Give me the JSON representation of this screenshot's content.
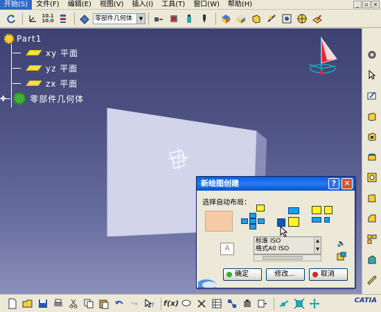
{
  "menu": {
    "items": [
      {
        "label": "开始(S)"
      },
      {
        "label": "文件(F)"
      },
      {
        "label": "编辑(E)"
      },
      {
        "label": "视图(V)"
      },
      {
        "label": "插入(I)"
      },
      {
        "label": "工具(T)"
      },
      {
        "label": "窗口(W)"
      },
      {
        "label": "帮助(H)"
      }
    ]
  },
  "toolbar_top": {
    "scale_text": "10.1\n10.0",
    "geometry_select": "零部件几何体"
  },
  "tree": {
    "root": "Part1",
    "planes": [
      "xy 平面",
      "yz 平面",
      "zx 平面"
    ],
    "geometry": "零部件几何体"
  },
  "dialog": {
    "title": "新绘图创建",
    "help": "?",
    "close": "✕",
    "section_label": "选择自动布局：",
    "preview_letter": "A",
    "standards": [
      "标准 ISO",
      "格式A0 ISO"
    ],
    "ok": "确定",
    "modify": "修改...",
    "cancel": "取消"
  },
  "brand": {
    "catia": "CATIA"
  },
  "colors": {
    "title_bar": "#0a5fe5",
    "viewport_top": "#3e4272",
    "viewport_bottom": "#8a8fb9",
    "plane_yellow": "#f6e33c"
  }
}
